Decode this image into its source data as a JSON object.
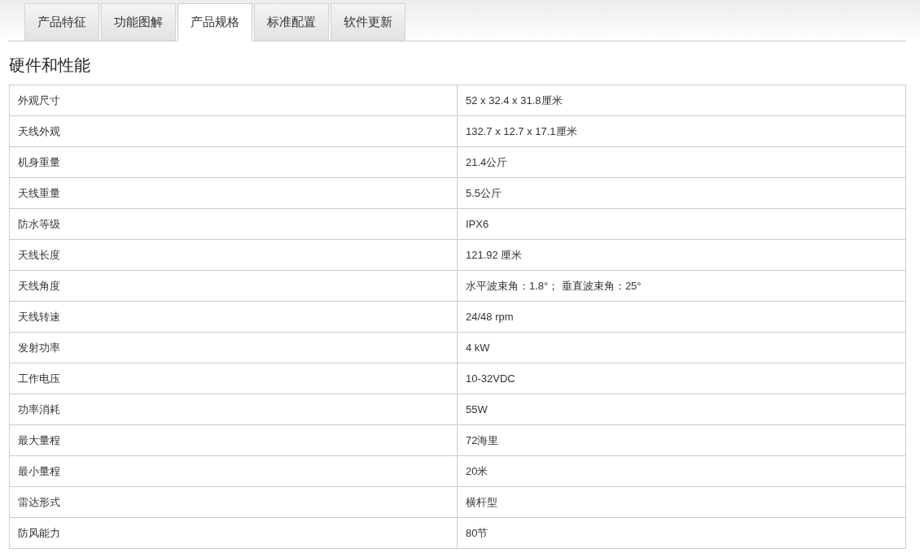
{
  "tabs": [
    {
      "label": "产品特征",
      "selected": false
    },
    {
      "label": "功能图解",
      "selected": false
    },
    {
      "label": "产品规格",
      "selected": true
    },
    {
      "label": "标准配置",
      "selected": false
    },
    {
      "label": "软件更新",
      "selected": false
    }
  ],
  "section_title": "硬件和性能",
  "table": {
    "rows": [
      {
        "label": "外观尺寸",
        "value": "52 x 32.4 x 31.8厘米"
      },
      {
        "label": "天线外观",
        "value": "132.7 x 12.7 x 17.1厘米"
      },
      {
        "label": "机身重量",
        "value": "21.4公斤"
      },
      {
        "label": "天线重量",
        "value": "5.5公斤"
      },
      {
        "label": "防水等级",
        "value": "IPX6"
      },
      {
        "label": "天线长度",
        "value": "121.92 厘米"
      },
      {
        "label": "天线角度",
        "value": "水平波束角：1.8°； 垂直波束角：25°"
      },
      {
        "label": "天线转速",
        "value": "24/48 rpm"
      },
      {
        "label": "发射功率",
        "value": "4 kW"
      },
      {
        "label": "工作电压",
        "value": "10-32VDC"
      },
      {
        "label": "功率消耗",
        "value": "55W"
      },
      {
        "label": "最大量程",
        "value": "72海里"
      },
      {
        "label": "最小量程",
        "value": "20米"
      },
      {
        "label": "雷达形式",
        "value": "横杆型"
      },
      {
        "label": "防风能力",
        "value": "80节"
      }
    ]
  }
}
